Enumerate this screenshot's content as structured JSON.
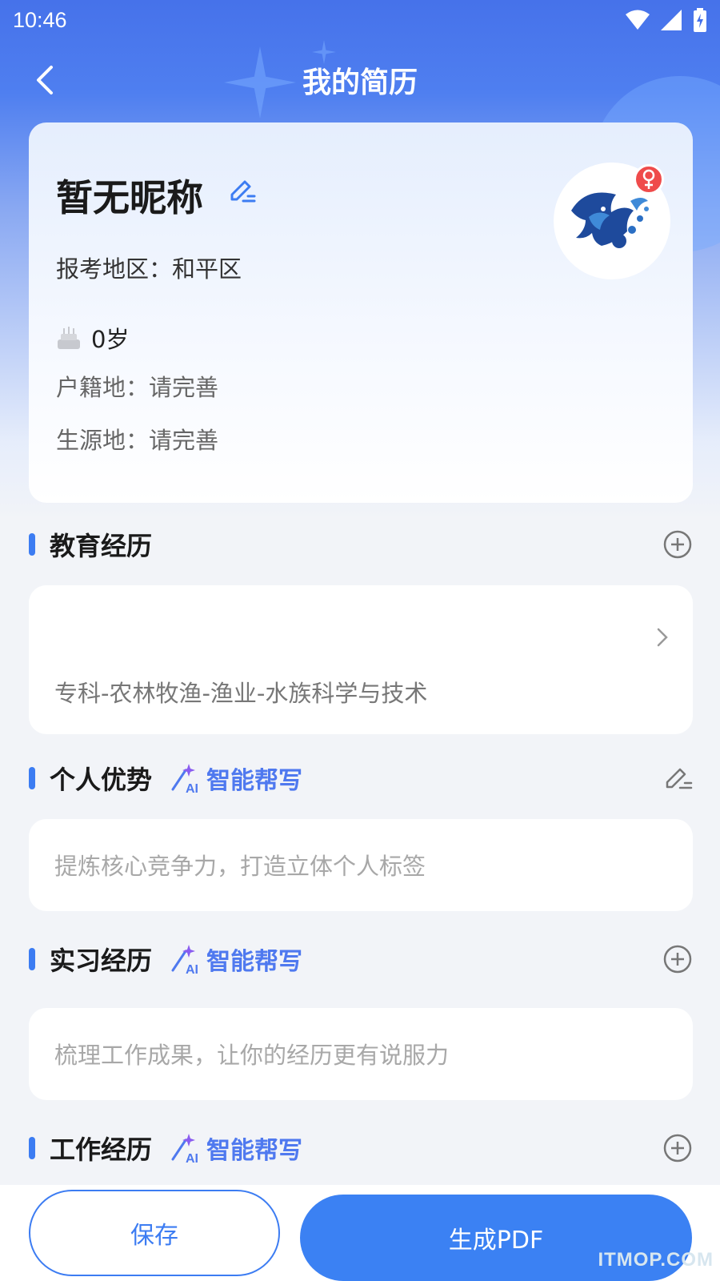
{
  "status_bar": {
    "time": "10:46"
  },
  "nav": {
    "title": "我的简历"
  },
  "profile": {
    "nickname": "暂无昵称",
    "region": "报考地区：和平区",
    "age": "0岁",
    "hukou": "户籍地：请完善",
    "origin": "生源地：请完善"
  },
  "education": {
    "title": "教育经历",
    "entry": "专科-农林牧渔-渔业-水族科学与技术"
  },
  "advantage": {
    "title": "个人优势",
    "ai_label": "智能帮写",
    "placeholder": "提炼核心竞争力，打造立体个人标签"
  },
  "internship": {
    "title": "实习经历",
    "ai_label": "智能帮写",
    "placeholder": "梳理工作成果，让你的经历更有说服力"
  },
  "work": {
    "title": "工作经历",
    "ai_label": "智能帮写"
  },
  "actions": {
    "save": "保存",
    "generate_pdf": "生成PDF"
  },
  "watermark": "ITMOP.COM",
  "colors": {
    "primary": "#3b81f3",
    "header": "#4672ea",
    "badge": "#ef4b4b"
  }
}
